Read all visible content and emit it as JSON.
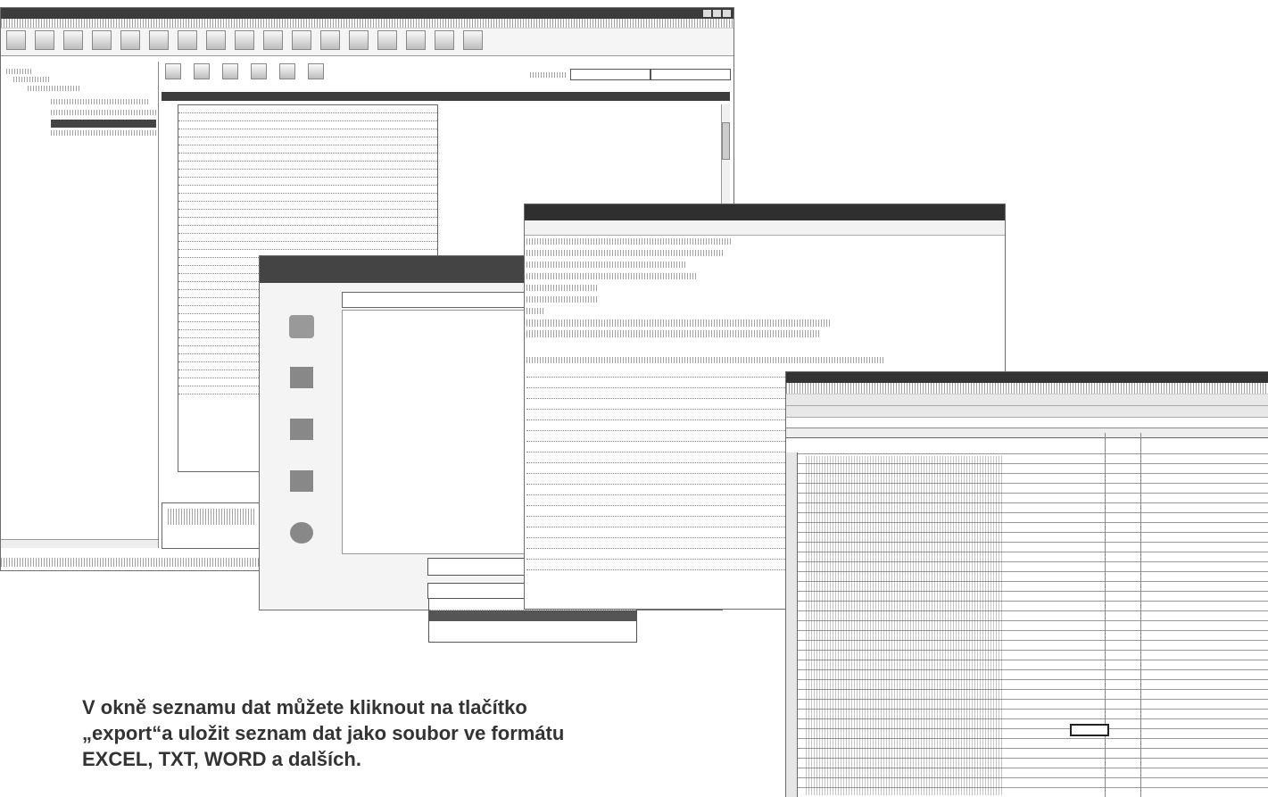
{
  "caption": {
    "line1": "V okně seznamu dat můžete kliknout na tlačítko",
    "line2": "„export“a uložit seznam dat jako soubor ve formátu",
    "line3": "EXCEL, TXT, WORD a dalších."
  },
  "app": {
    "title": "",
    "side_box": ""
  },
  "save_dialog": {
    "title": "",
    "location_label": "",
    "location_value": "",
    "filename_label": "",
    "filetype_label": "",
    "filetype_value": "",
    "save_button": "",
    "places": [
      "",
      "",
      "",
      "",
      ""
    ],
    "type_options": [
      "",
      "",
      "",
      ""
    ]
  },
  "notepad": {
    "title": "",
    "menu": "",
    "lines": [],
    "table_header": "",
    "rows": []
  },
  "excel": {
    "title": "",
    "cell_ref": ""
  }
}
